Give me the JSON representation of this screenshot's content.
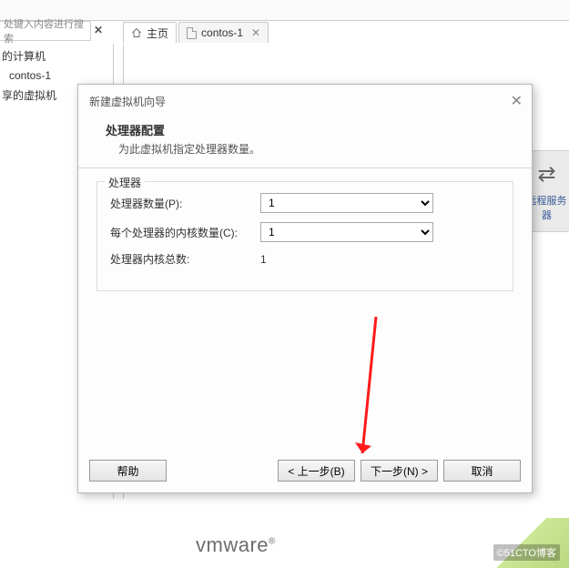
{
  "search": {
    "placeholder": "处键入内容进行搜索"
  },
  "tabs": {
    "home": {
      "label": "主页"
    },
    "vm": {
      "label": "contos-1"
    }
  },
  "sidebar": {
    "items": [
      {
        "label": "的计算机"
      },
      {
        "label": "contos-1"
      },
      {
        "label": "享的虚拟机"
      }
    ]
  },
  "rightPanel": {
    "label": "远程服务器"
  },
  "dialog": {
    "title": "新建虚拟机向导",
    "heading": "处理器配置",
    "subheading": "为此虚拟机指定处理器数量。",
    "legend": "处理器",
    "rows": {
      "procCount": {
        "label": "处理器数量(P):",
        "value": "1"
      },
      "coresPerProc": {
        "label": "每个处理器的内核数量(C):",
        "value": "1"
      },
      "totalCores": {
        "label": "处理器内核总数:",
        "value": "1"
      }
    },
    "buttons": {
      "help": "帮助",
      "back": "< 上一步(B)",
      "next": "下一步(N) >",
      "cancel": "取消"
    }
  },
  "logo": "vmware",
  "watermark": "©51CTO博客"
}
